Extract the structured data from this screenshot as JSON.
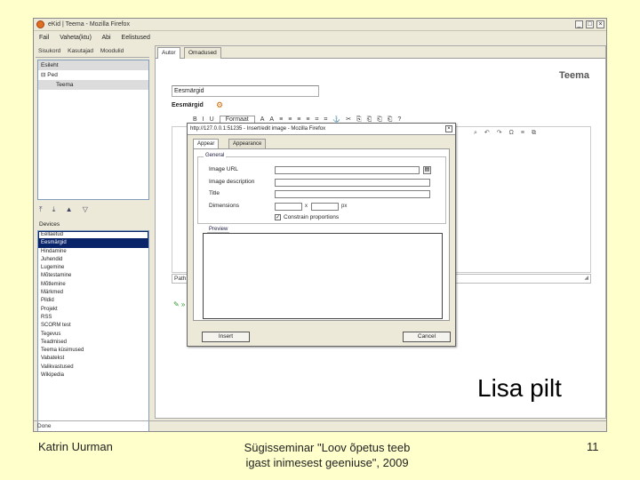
{
  "window": {
    "title": "eKid | Teema - Mozilla Firefox",
    "controls": [
      "_",
      "□",
      "×"
    ],
    "menu": [
      "Fail",
      "Vaheta(ktu)",
      "Abi",
      "Eelistused"
    ],
    "status": "Done"
  },
  "sidebar": {
    "tabs": [
      "Sisukord",
      "Kasutajad",
      "Moodulid"
    ],
    "tree": [
      {
        "label": "Esileht",
        "selected": true
      },
      {
        "label": "Ped",
        "selected": false
      },
      {
        "label": "Teema",
        "selected": true
      }
    ],
    "icons": [
      "move-up-icon",
      "move-down-icon",
      "arrow-up-icon",
      "arrow-down-icon"
    ],
    "devices_label": "Devices",
    "devices": [
      {
        "label": "Eellaetud",
        "state": "box"
      },
      {
        "label": "Eesmärgid",
        "state": "selected"
      },
      {
        "label": "Hindamine",
        "state": ""
      },
      {
        "label": "Juhendid",
        "state": ""
      },
      {
        "label": "Lugemine",
        "state": ""
      },
      {
        "label": "Mõtestamine",
        "state": ""
      },
      {
        "label": "Mõtlemine",
        "state": ""
      },
      {
        "label": "Märkmed",
        "state": ""
      },
      {
        "label": "Pildid",
        "state": ""
      },
      {
        "label": "Projekt",
        "state": ""
      },
      {
        "label": "RSS",
        "state": ""
      },
      {
        "label": "SCORM test",
        "state": ""
      },
      {
        "label": "Tegevus",
        "state": ""
      },
      {
        "label": "Teadmised",
        "state": ""
      },
      {
        "label": "Teema küsimused",
        "state": ""
      },
      {
        "label": "Vabatekst",
        "state": ""
      },
      {
        "label": "Valikvastused",
        "state": ""
      },
      {
        "label": "Wikipedia",
        "state": ""
      }
    ]
  },
  "content": {
    "tabs": [
      "Autor",
      "Omadused"
    ],
    "page_title": "Teema",
    "field_value": "Eesmärgid",
    "field_label": "Eesmärgid",
    "toolbar": [
      "B",
      "I",
      "U",
      "Formaat",
      "A",
      "A",
      "≡",
      "≡",
      "≡",
      "≡",
      "⌗",
      "⌗",
      "⚓",
      "✂",
      "⎘",
      "⎗",
      "⎗",
      "⎗",
      "?"
    ],
    "toolbar2": [
      "⌕",
      "↶",
      "↷",
      "Ω",
      "≡",
      "⧉"
    ],
    "path_label": "Path:",
    "bottom_icons": "✎ »"
  },
  "dialog": {
    "title": "http://127.0.0.1:51235 - Insert/edit image - Mozilla Firefox",
    "tabs": [
      "Appear",
      "Appearance"
    ],
    "general_legend": "General",
    "fields": [
      {
        "label": "Image URL",
        "value": ""
      },
      {
        "label": "Image description",
        "value": ""
      },
      {
        "label": "Title",
        "value": ""
      }
    ],
    "dimensions_label": "Dimensions",
    "dim_sep": "x",
    "dim_unit": "px",
    "constrain_label": "Constrain proportions",
    "constrain_checked": "✓",
    "preview_legend": "Preview",
    "insert_label": "Insert",
    "cancel_label": "Cancel"
  },
  "slide": {
    "caption": "Lisa pilt",
    "author": "Katrin Uurman",
    "event_line1": "Sügisseminar \"Loov õpetus teeb",
    "event_line2": "igast inimesest geeniuse\", 2009",
    "page_number": "11"
  }
}
